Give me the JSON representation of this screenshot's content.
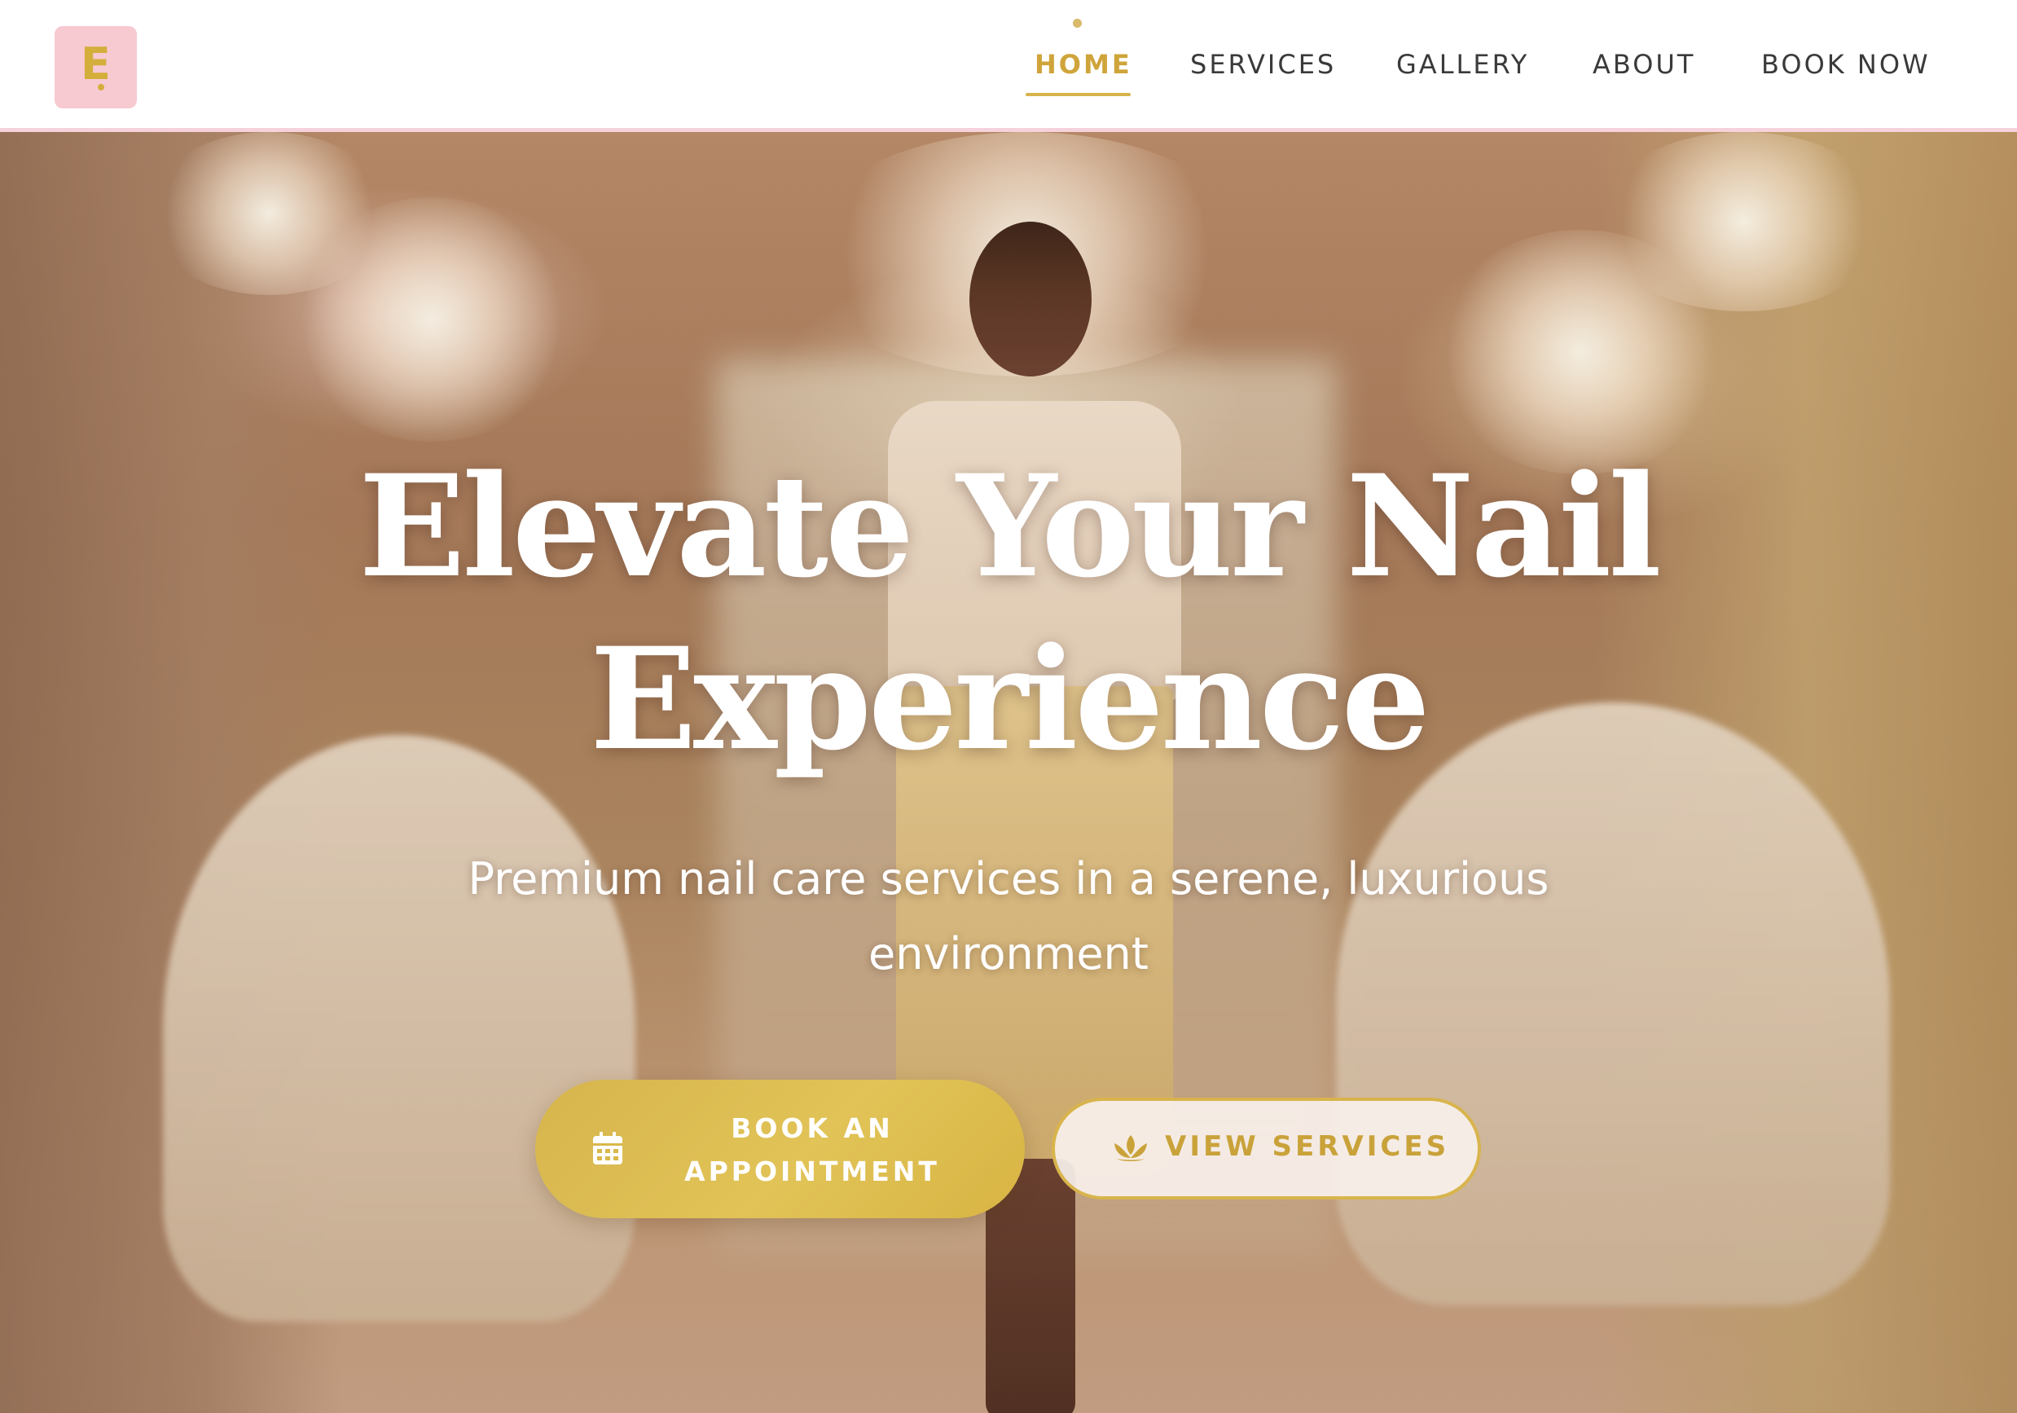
{
  "header": {
    "logo_letter": "E",
    "nav": [
      {
        "label": "HOME",
        "active": true
      },
      {
        "label": "SERVICES",
        "active": false
      },
      {
        "label": "GALLERY",
        "active": false
      },
      {
        "label": "ABOUT",
        "active": false
      },
      {
        "label": "BOOK NOW",
        "active": false
      }
    ]
  },
  "hero": {
    "title_line1": "Elevate Your Nail",
    "title_line2": "Experience",
    "subtitle": "Premium nail care services in a serene, luxurious environment",
    "primary_button": {
      "line1": "BOOK AN",
      "line2": "APPOINTMENT",
      "icon": "calendar-icon"
    },
    "secondary_button": {
      "label": "VIEW SERVICES",
      "icon": "lotus-icon"
    }
  },
  "colors": {
    "accent_gold": "#d6b54d",
    "logo_background": "#f7c9d1",
    "nav_text": "#3a3a3a",
    "nav_active": "#cfa43a",
    "header_border": "#f6d3dc"
  }
}
